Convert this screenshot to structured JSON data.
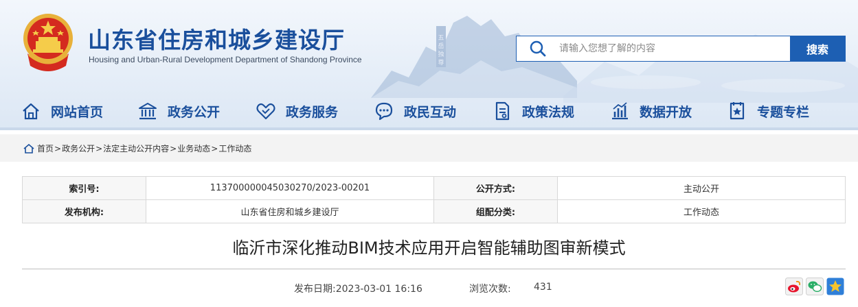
{
  "header": {
    "title": "山东省住房和城乡建设厅",
    "subtitle": "Housing and Urban-Rural Development Department of Shandong Province",
    "emblem_icon": "national-emblem-icon"
  },
  "search": {
    "placeholder": "请输入您想了解的内容",
    "button_label": "搜索"
  },
  "nav": {
    "items": [
      {
        "label": "网站首页",
        "icon": "home-icon"
      },
      {
        "label": "政务公开",
        "icon": "building-icon"
      },
      {
        "label": "政务服务",
        "icon": "handshake-icon"
      },
      {
        "label": "政民互动",
        "icon": "chat-icon"
      },
      {
        "label": "政策法规",
        "icon": "document-icon"
      },
      {
        "label": "数据开放",
        "icon": "chart-icon"
      },
      {
        "label": "专题专栏",
        "icon": "star-folder-icon"
      }
    ]
  },
  "breadcrumb": {
    "items": [
      "首页",
      "政务公开",
      "法定主动公开内容",
      "业务动态",
      "工作动态"
    ],
    "separator": ">"
  },
  "info": {
    "index_label": "索引号:",
    "index_value": "11370000004503027​0/2023-00201",
    "open_mode_label": "公开方式:",
    "open_mode_value": "主动公开",
    "publisher_label": "发布机构:",
    "publisher_value": "山东省住房和城乡建设厅",
    "category_label": "组配分类:",
    "category_value": "工作动态"
  },
  "article": {
    "title": "临沂市深化推动BIM技术应用开启智能辅助图审新模式",
    "publish_date": "发布日期:2023-03-01 16:16",
    "views_label": "浏览次数:",
    "views_value": "431"
  },
  "share": {
    "weibo_icon": "weibo-icon",
    "wechat_icon": "wechat-icon",
    "qzone_icon": "qzone-icon"
  },
  "colors": {
    "brand_blue": "#1a4f9c",
    "search_blue": "#1d5fb3",
    "crumb_bg": "#f3f3f3"
  }
}
